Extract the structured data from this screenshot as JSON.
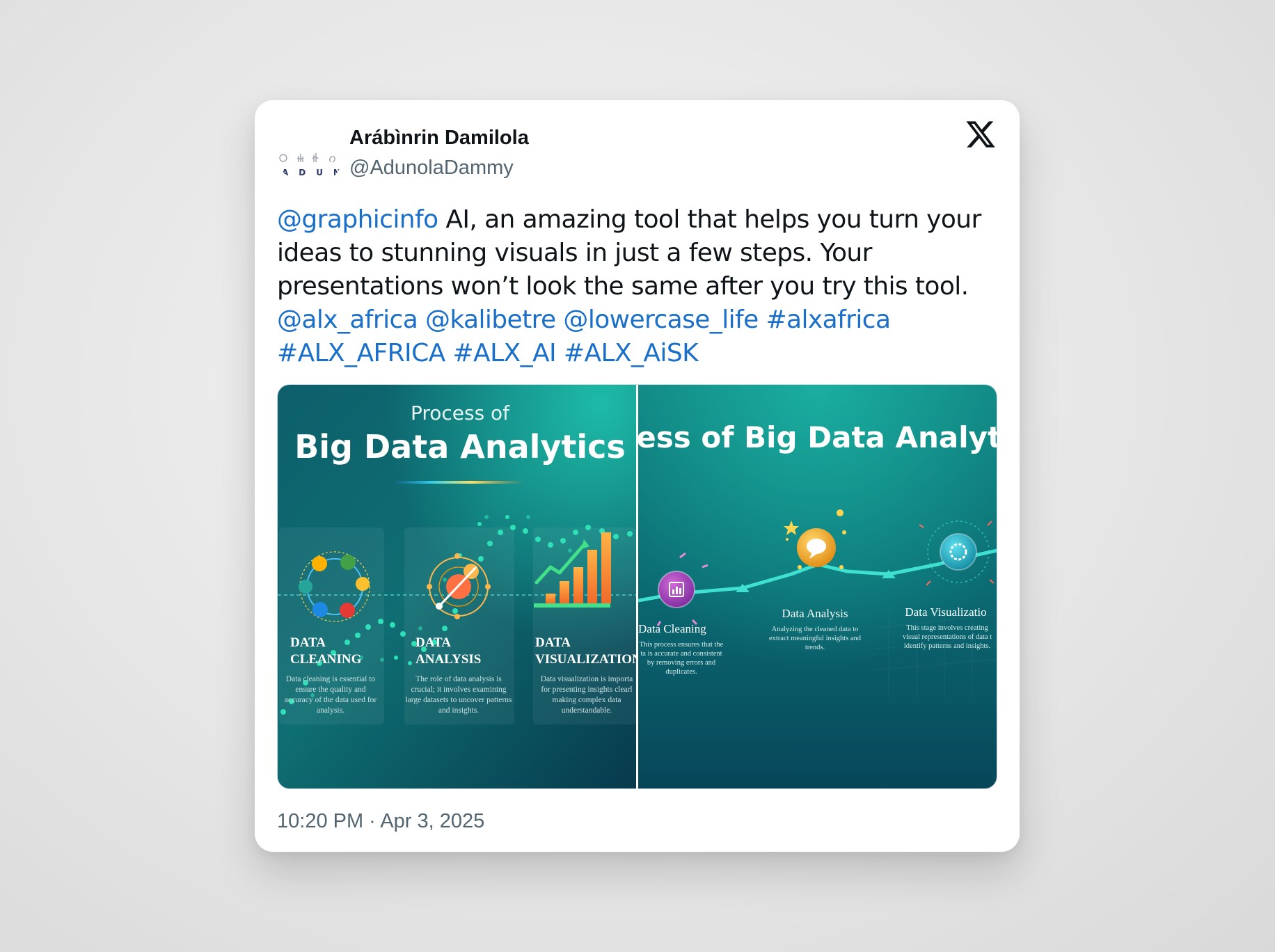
{
  "user": {
    "display_name": "Arábìnrin Damilola",
    "handle": "@AdunolaDammy",
    "avatar_letters": [
      "A",
      "D",
      "U",
      "N"
    ]
  },
  "tweet": {
    "mention_1": "@graphicinfo",
    "body": " AI, an amazing tool that helps you turn your ideas to stunning visuals in just a few steps. Your presentations won’t look the same after you try this tool.",
    "tags": [
      "@alx_africa",
      "@kalibetre",
      "@lowercase_life",
      "#alxafrica",
      "#ALX_AFRICA",
      "#ALX_AI",
      "#ALX_AiSK"
    ],
    "timestamp": "10:20 PM · Apr 3, 2025"
  },
  "image_1": {
    "subtitle": "Process of",
    "title": "Big Data Analytics",
    "steps": [
      {
        "line1": "DATA",
        "line2": "CLEANING",
        "desc": [
          "Data cleaning is essential to",
          "ensure the quality and",
          "accuracy of the data used for",
          "analysis."
        ]
      },
      {
        "line1": "DATA",
        "line2": "ANALYSIS",
        "desc": [
          "The role of data analysis is",
          "crucial; it involves examining",
          "large datasets to uncover patterns",
          "and insights."
        ]
      },
      {
        "line1": "DATA",
        "line2": "VISUALIZATION",
        "desc": [
          "Data visualization is importa",
          "for presenting insights clearl",
          "making complex data",
          "understandable."
        ]
      }
    ]
  },
  "image_2": {
    "title": "ocess of Big Data Analyti",
    "steps": [
      {
        "label": "Data Cleaning",
        "desc": [
          "This process ensures that the",
          "ta is accurate and consistent",
          "by removing errors and",
          "duplicates."
        ]
      },
      {
        "label": "Data Analysis",
        "desc": [
          "Analyzing the cleaned data to",
          "extract meaningful insights and",
          "trends."
        ]
      },
      {
        "label": "Data Visualizatio",
        "desc": [
          "This stage involves creating",
          "visual representations of data t",
          "identify patterns and insights."
        ]
      }
    ]
  },
  "colors": {
    "link": "#1a6fc9",
    "text": "#0f1419",
    "secondary": "#536471",
    "teal_dark": "#0a3f4f",
    "teal_light": "#18b3a4"
  }
}
